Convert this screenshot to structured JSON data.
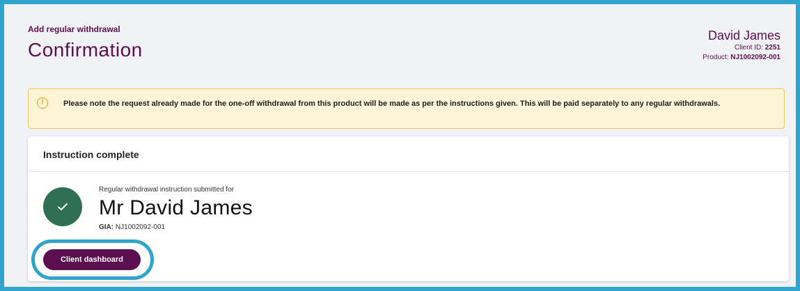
{
  "header": {
    "breadcrumb": "Add regular withdrawal",
    "title": "Confirmation",
    "client": {
      "name": "David James",
      "client_id_label": "Client ID:",
      "client_id": "2251",
      "product_label": "Product:",
      "product": "NJ1002092-001"
    }
  },
  "notice": {
    "icon": "info-icon",
    "text": "Please note the request already made for the one-off withdrawal from this product will be made as per the instructions given. This will be paid separately to any regular withdrawals."
  },
  "card": {
    "title": "Instruction complete",
    "status_icon": "check-icon",
    "submitted_label": "Regular withdrawal instruction submitted for",
    "client_fullname": "Mr David James",
    "product_type": "GIA",
    "product_ref": "NJ1002092-001",
    "button_label": "Client dashboard"
  },
  "colors": {
    "brand": "#5b0f4e",
    "highlight": "#2fa4cc",
    "success": "#2f7055",
    "notice_bg": "#fdf3d6",
    "notice_border": "#e7c75c"
  }
}
